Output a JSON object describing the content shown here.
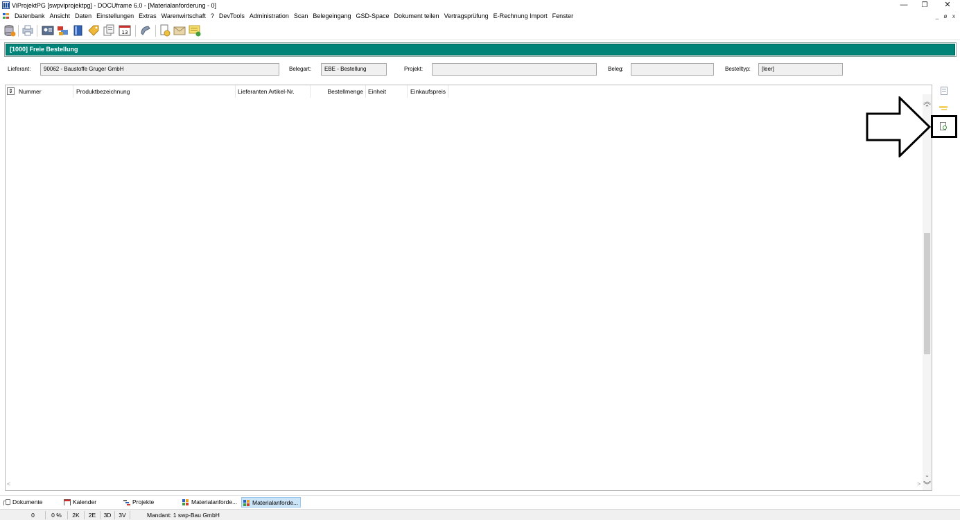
{
  "window": {
    "title": "ViProjektPG [swpviprojektpg] - DOCUframe 6.0 - [Materialanforderung - 0]",
    "minimize": "—",
    "maximize": "❐",
    "close": "✕"
  },
  "menu": {
    "items": [
      "Datenbank",
      "Ansicht",
      "Daten",
      "Einstellungen",
      "Extras",
      "Warenwirtschaft",
      "?",
      "DevTools",
      "Administration",
      "Scan",
      "Belegeingang",
      "GSD-Space",
      "Dokument teilen",
      "Vertragsprüfung",
      "E-Rechnung Import",
      "Fenster"
    ],
    "mdi_minimize": "_",
    "mdi_restore": "ø",
    "mdi_close": "x"
  },
  "toolbar": {
    "icons": [
      "database-icon",
      "print-icon",
      "contact-card-icon",
      "tasks-icon",
      "book-icon",
      "tag-icon",
      "documents-icon",
      "calendar-icon",
      "phone-icon",
      "new-document-icon",
      "mail-icon",
      "note-icon"
    ],
    "calendar_day": "13"
  },
  "panel": {
    "header": "[1000] Freie Bestellung"
  },
  "form": {
    "lieferant_label": "Lieferant:",
    "lieferant_value": "90062 - Baustoffe Gruger GmbH",
    "belegart_label": "Belegart:",
    "belegart_value": "EBE - Bestellung",
    "projekt_label": "Projekt:",
    "projekt_value": "",
    "beleg_label": "Beleg:",
    "beleg_value": "",
    "bestelltyp_label": "Bestelltyp:",
    "bestelltyp_value": "[leer]"
  },
  "grid": {
    "sort_icon": "⇕",
    "columns": [
      "Nummer",
      "Produktbezeichnung",
      "Lieferanten Artikel-Nr.",
      "Bestellmenge",
      "Einheit",
      "Einkaufspreis"
    ]
  },
  "scroll": {
    "up_top": "︽",
    "up": "⌃",
    "down": "⌄",
    "down_bottom": "︾",
    "left": "<",
    "right": ">"
  },
  "taskbar": {
    "items": [
      {
        "label": "Dokumente",
        "icon": "documents-icon"
      },
      {
        "label": "Kalender",
        "icon": "calendar-icon"
      },
      {
        "label": "Projekte",
        "icon": "projects-icon"
      },
      {
        "label": "Materialanforde...",
        "icon": "material-request-icon"
      },
      {
        "label": "Materialanforde...",
        "icon": "material-request-icon"
      }
    ]
  },
  "statusbar": {
    "cells": [
      "0",
      "0 %",
      "2K",
      "2E",
      "3D",
      "3V"
    ],
    "mandant": "Mandant: 1 swp-Bau GmbH"
  },
  "colors": {
    "panel_header": "#00847a",
    "highlight": "#000000"
  }
}
